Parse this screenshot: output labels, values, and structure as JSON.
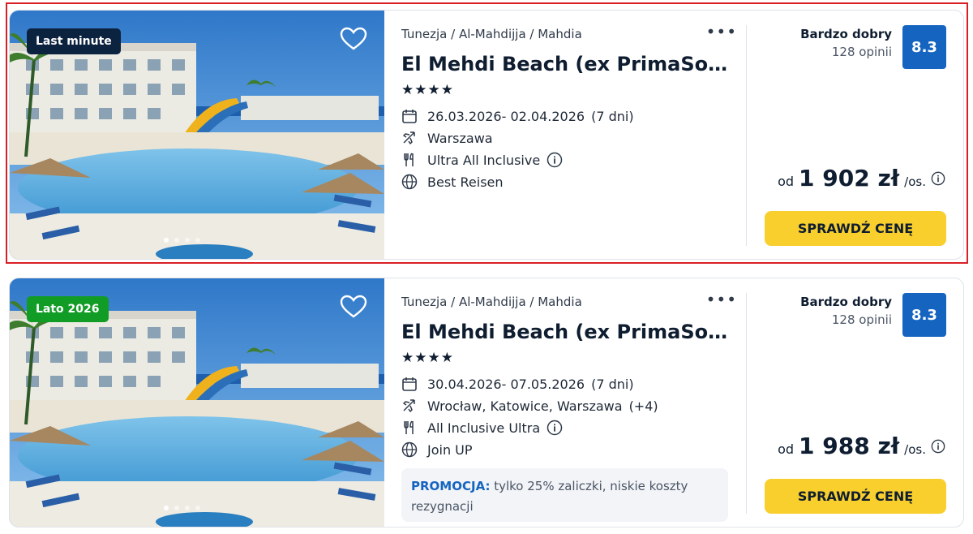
{
  "offers": [
    {
      "badge": "Last minute",
      "badge_color": "#0c2340",
      "location": "Tunezja / Al-Mahdijja / Mahdia",
      "title": "El Mehdi Beach (ex PrimaSol El …",
      "stars": "★★★★",
      "dates": "26.03.2026- 02.04.2026",
      "duration": "(7 dni)",
      "departure": "Warszawa",
      "departure_extra": "",
      "board": "Ultra All Inclusive",
      "operator": "Best Reisen",
      "rating_word": "Bardzo dobry",
      "rating_count": "128 opinii",
      "score": "8.3",
      "price_prefix": "od",
      "price": "1 902 zł",
      "price_suffix": "/os.",
      "cta": "SPRAWDŹ CENĘ"
    },
    {
      "badge": "Lato 2026",
      "badge_color": "#119c26",
      "location": "Tunezja / Al-Mahdijja / Mahdia",
      "title": "El Mehdi Beach (ex PrimaSol El …",
      "stars": "★★★★",
      "dates": "30.04.2026- 07.05.2026",
      "duration": "(7 dni)",
      "departure": "Wrocław, Katowice, Warszawa",
      "departure_extra": "(+4)",
      "board": "All Inclusive Ultra",
      "operator": "Join UP",
      "promo_label": "PROMOCJA:",
      "promo_text": "tylko 25% zaliczki, niskie koszty rezygnacji",
      "rating_word": "Bardzo dobry",
      "rating_count": "128 opinii",
      "score": "8.3",
      "price_prefix": "od",
      "price": "1 988 zł",
      "price_suffix": "/os.",
      "cta": "SPRAWDŹ CENĘ"
    }
  ],
  "icons": {
    "heart": "heart-icon",
    "more": "more-dots-icon",
    "calendar": "calendar-icon",
    "plane": "plane-icon",
    "food": "cutlery-icon",
    "globe": "globe-icon",
    "info": "info-icon"
  },
  "colors": {
    "highlight": "#d91f26",
    "score_bg": "#1565c0",
    "cta_bg": "#f8cf2c",
    "promo_label": "#1565c0"
  }
}
